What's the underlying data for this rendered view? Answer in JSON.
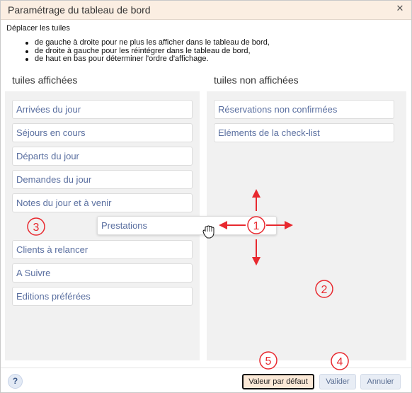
{
  "dialog": {
    "title": "Paramétrage du tableau de bord",
    "close_glyph": "✕"
  },
  "instructions": {
    "intro": "Déplacer les tuiles",
    "bullets": [
      "de gauche à droite pour ne plus les afficher dans le tableau de bord,",
      "de droite à gauche pour les réintégrer dans le tableau de bord,",
      "de haut en bas pour déterminer l'ordre d'affichage."
    ]
  },
  "columns": {
    "displayed": {
      "heading": "tuiles affichées",
      "tiles": [
        "Arrivées du jour",
        "Séjours en cours",
        "Départs du jour",
        "Demandes du jour",
        "Notes du jour et à venir",
        "Clients à relancer",
        "A Suivre",
        "Editions préférées"
      ]
    },
    "hidden": {
      "heading": "tuiles non affichées",
      "tiles": [
        "Réservations non confirmées",
        "Eléments de la check-list"
      ]
    }
  },
  "dragging_tile": {
    "label": "Prestations"
  },
  "annotations": {
    "markers": [
      "1",
      "2",
      "3",
      "4",
      "5"
    ],
    "color": "#e8292f"
  },
  "footer": {
    "help_label": "?",
    "default_label": "Valeur par défaut",
    "validate_label": "Valider",
    "cancel_label": "Annuler"
  },
  "colors": {
    "titlebar_bg": "#fbeee2",
    "tile_text": "#5a6fa0",
    "panel_bg": "#f1f1f1",
    "default_button_bg": "#fbe9d7"
  },
  "icons": {
    "cursor": "hand-grab-cursor-icon",
    "close": "close-icon",
    "help": "help-icon"
  }
}
